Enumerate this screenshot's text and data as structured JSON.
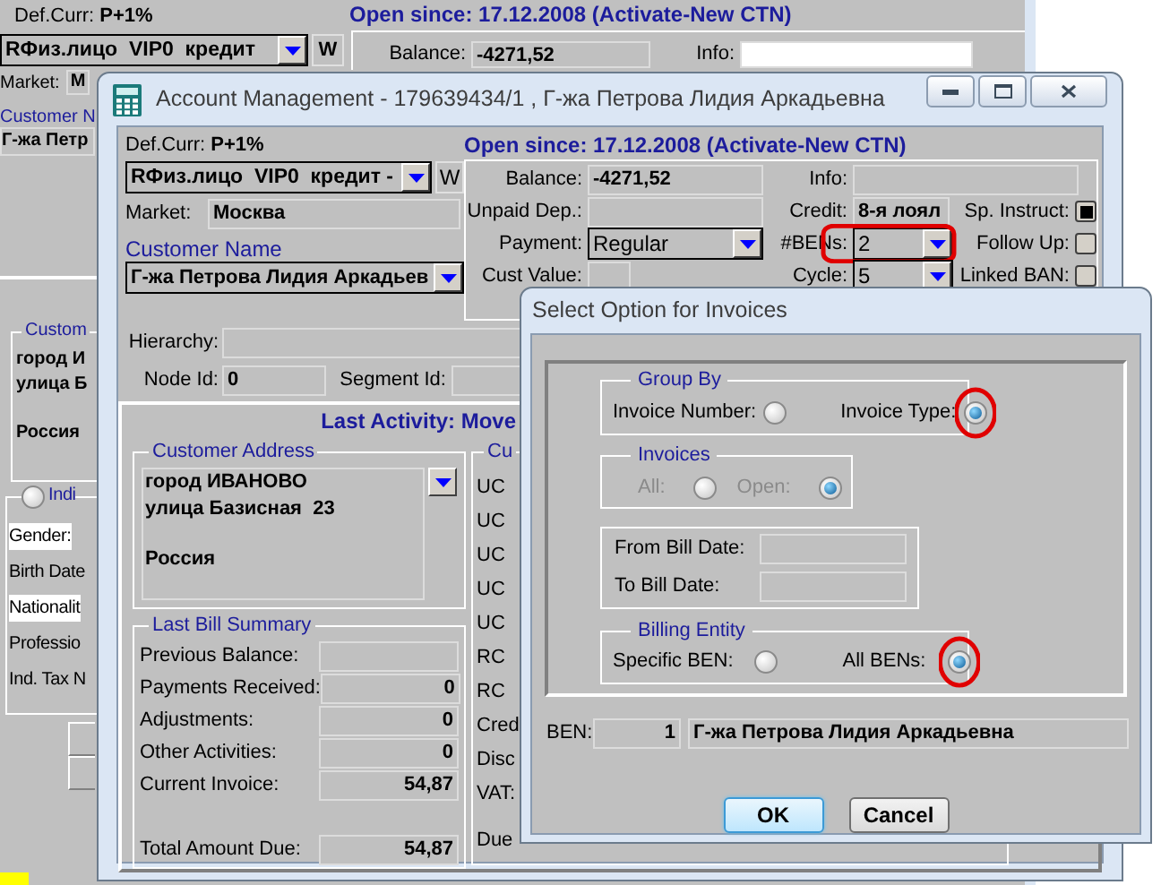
{
  "background_window": {
    "def_curr": {
      "label": "Def.Curr:",
      "value": "P+1%"
    },
    "open_since": "Open since: 17.12.2008 (Activate-New CTN)",
    "account_type": "RФиз.лицо  VIP0  кредит",
    "w_button": "W",
    "balance": {
      "label": "Balance:",
      "value": "-4271,52"
    },
    "info": {
      "label": "Info:"
    },
    "market": {
      "label": "Market:",
      "value": "М"
    },
    "customer_name": {
      "label": "Customer N",
      "value": "Г-жа Петр"
    },
    "address": {
      "label": "Custom",
      "street_lines": [
        "город И",
        "улица Б"
      ],
      "country": "Россия"
    },
    "individual": {
      "label": "Indi",
      "selected": false,
      "fields": [
        {
          "label": "Gender:",
          "highlighted": true
        },
        {
          "label": "Birth Date",
          "highlighted": false
        },
        {
          "label": "Nationalit",
          "highlighted": true
        },
        {
          "label": "Professio",
          "highlighted": false
        },
        {
          "label": "Ind. Tax N",
          "highlighted": false
        }
      ]
    }
  },
  "account_window": {
    "title": "Account Management - 179639434/1 , Г-жа Петрова Лидия Аркадьевна",
    "def_curr": {
      "label": "Def.Curr:",
      "value": "P+1%"
    },
    "account_type": "RФиз.лицо  VIP0  кредит -",
    "w_button": "W",
    "market": {
      "label": "Market:",
      "value": "Москва"
    },
    "customer_name": {
      "label": "Customer Name",
      "value": "Г-жа Петрова Лидия Аркадьев"
    },
    "open_since": "Open since: 17.12.2008 (Activate-New CTN)",
    "details": [
      [
        {
          "kind": "field",
          "label": "Balance:",
          "value": "-4271,52"
        },
        {
          "kind": "wide_field",
          "label": "Info:"
        }
      ],
      [
        {
          "kind": "field",
          "label": "Unpaid Dep.:"
        },
        {
          "kind": "field",
          "label": "Credit:",
          "value": "8-я лоял"
        },
        {
          "kind": "check",
          "label": "Sp. Instruct:",
          "checked": true
        }
      ],
      [
        {
          "kind": "combo",
          "label": "Payment:",
          "value": "Regular",
          "highlighted": false
        },
        {
          "kind": "combo",
          "label": "#BENs:",
          "value": "2",
          "highlighted": true
        },
        {
          "kind": "check",
          "label": "Follow Up:",
          "checked": false
        }
      ],
      [
        {
          "kind": "short_field",
          "label": "Cust Value:"
        },
        {
          "kind": "combo",
          "label": "Cycle:",
          "value": "5",
          "highlighted": false
        },
        {
          "kind": "check",
          "label": "Linked BAN:",
          "checked": false
        }
      ]
    ],
    "hierarchy": {
      "label": "Hierarchy:"
    },
    "node_id": {
      "label": "Node Id:",
      "value": "0"
    },
    "segment_id": {
      "label": "Segment Id:"
    },
    "last_activity": "Last Activity: Move",
    "customer_address": {
      "label": "Customer Address",
      "street_lines": [
        "город ИВАНОВО",
        "улица Базисная  23"
      ],
      "country": "Россия"
    },
    "last_bill_summary": {
      "label": "Last Bill Summary",
      "rows": [
        {
          "kind": "line",
          "label": "Previous Balance:"
        },
        {
          "kind": "line",
          "label": "Payments Received:",
          "value": "0"
        },
        {
          "kind": "line",
          "label": "Adjustments:",
          "value": "0"
        },
        {
          "kind": "line",
          "label": "Other Activities:",
          "value": "0"
        },
        {
          "kind": "line",
          "label": "Current Invoice:",
          "value": "54,87"
        },
        {
          "kind": "total",
          "label": "Total Amount Due:",
          "value": "54,87"
        }
      ]
    },
    "charges": {
      "label": "Cu",
      "items": [
        "UC",
        "UC",
        "UC",
        "UC",
        "UC",
        "RC",
        "RC",
        "Cred",
        "Disc",
        "VAT:"
      ],
      "footer": "Due"
    }
  },
  "dialog": {
    "title": "Select Option for Invoices",
    "group_by": {
      "label": "Group By",
      "disabled": false,
      "options": [
        {
          "label": "Invoice Number:",
          "selected": false,
          "highlighted": false
        },
        {
          "label": "Invoice Type:",
          "selected": true,
          "highlighted": true
        }
      ]
    },
    "invoices": {
      "label": "Invoices",
      "disabled": true,
      "options": [
        {
          "label": "All:",
          "selected": false,
          "highlighted": false
        },
        {
          "label": "Open:",
          "selected": true,
          "highlighted": false
        }
      ]
    },
    "bill_dates": [
      {
        "label": "From Bill Date:"
      },
      {
        "label": "To Bill Date:"
      }
    ],
    "billing_entity": {
      "label": "Billing Entity",
      "disabled": false,
      "options": [
        {
          "label": "Specific BEN:",
          "selected": false,
          "highlighted": false
        },
        {
          "label": "All BENs:",
          "selected": true,
          "highlighted": true
        }
      ]
    },
    "ben": {
      "label": "BEN:",
      "number": "1",
      "name": "Г-жа Петрова Лидия Аркадьевна"
    },
    "buttons": [
      {
        "label": "OK",
        "default": true
      },
      {
        "label": "Cancel",
        "default": false
      }
    ]
  }
}
